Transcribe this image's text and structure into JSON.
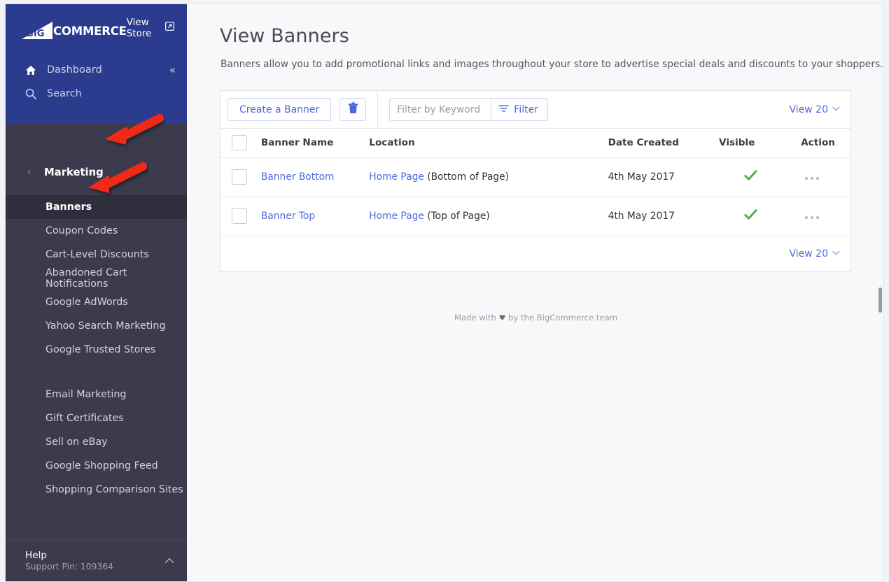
{
  "sidebar": {
    "brand": {
      "mark": "bigcommerce-logo-icon",
      "word": "COMMERCE",
      "knockout": "BIG"
    },
    "view_store": {
      "label": "View Store",
      "icon": "external-link-icon"
    },
    "primary": [
      {
        "label": "Dashboard",
        "icon": "home-icon"
      },
      {
        "label": "Search",
        "icon": "search-icon"
      }
    ],
    "collapse": {
      "icon": "chevron-double-left-icon",
      "glyph": "«"
    },
    "section": {
      "label": "Marketing",
      "back_icon": "chevron-left-icon",
      "back_glyph": "‹"
    },
    "items": [
      {
        "label": "Banners",
        "active": true
      },
      {
        "label": "Coupon Codes",
        "active": false
      },
      {
        "label": "Cart-Level Discounts",
        "active": false
      },
      {
        "label": "Abandoned Cart Notifications",
        "active": false
      },
      {
        "label": "Google AdWords",
        "active": false
      },
      {
        "label": "Yahoo Search Marketing",
        "active": false
      },
      {
        "label": "Google Trusted Stores",
        "active": false
      }
    ],
    "items2": [
      {
        "label": "Email Marketing",
        "active": false
      },
      {
        "label": "Gift Certificates",
        "active": false
      },
      {
        "label": "Sell on eBay",
        "active": false
      },
      {
        "label": "Google Shopping Feed",
        "active": false
      },
      {
        "label": "Shopping Comparison Sites",
        "active": false
      }
    ],
    "help": {
      "title": "Help",
      "support_pin": "Support Pin: 109364",
      "caret_icon": "chevron-up-icon",
      "caret_glyph": "⌃"
    }
  },
  "main": {
    "title": "View Banners",
    "description": "Banners allow you to add promotional links and images throughout your store to advertise special deals and discounts to your shoppers.",
    "toolbar": {
      "create_label": "Create a Banner",
      "delete_icon": "trash-icon",
      "filter_placeholder": "Filter by Keyword",
      "filter_value": "",
      "filter_button_label": "Filter",
      "filter_icon": "filter-icon",
      "view_count_label": "View 20",
      "caret_icon": "chevron-down-icon",
      "caret_glyph": "⌄"
    },
    "table": {
      "columns": [
        "Banner Name",
        "Location",
        "Date Created",
        "Visible",
        "Action"
      ],
      "rows": [
        {
          "name": "Banner Bottom",
          "location_link": "Home Page",
          "location_detail": "(Bottom of Page)",
          "date_created": "4th May 2017",
          "visible": true,
          "visible_icon": "green-check-icon",
          "action_icon": "ellipsis-icon"
        },
        {
          "name": "Banner Top",
          "location_link": "Home Page",
          "location_detail": "(Top of Page)",
          "date_created": "4th May 2017",
          "visible": true,
          "visible_icon": "green-check-icon",
          "action_icon": "ellipsis-icon"
        }
      ]
    },
    "footer_view_count": "View 20",
    "made_with": {
      "pre": "Made with",
      "heart": "♥",
      "post": "by the BigCommerce team"
    }
  },
  "annotations": [
    {
      "name": "arrow-pointing-to-marketing",
      "target": "Marketing"
    },
    {
      "name": "arrow-pointing-to-banners",
      "target": "Banners"
    }
  ],
  "colors": {
    "nav_blue": "#2b3c8e",
    "sidebar_dark": "#3b3b4d",
    "sidebar_active": "#2e2e3d",
    "accent_link": "#5068e0",
    "success_green": "#4caf50",
    "annotation_red": "#f02b14",
    "page_bg": "#f7f8fa"
  }
}
